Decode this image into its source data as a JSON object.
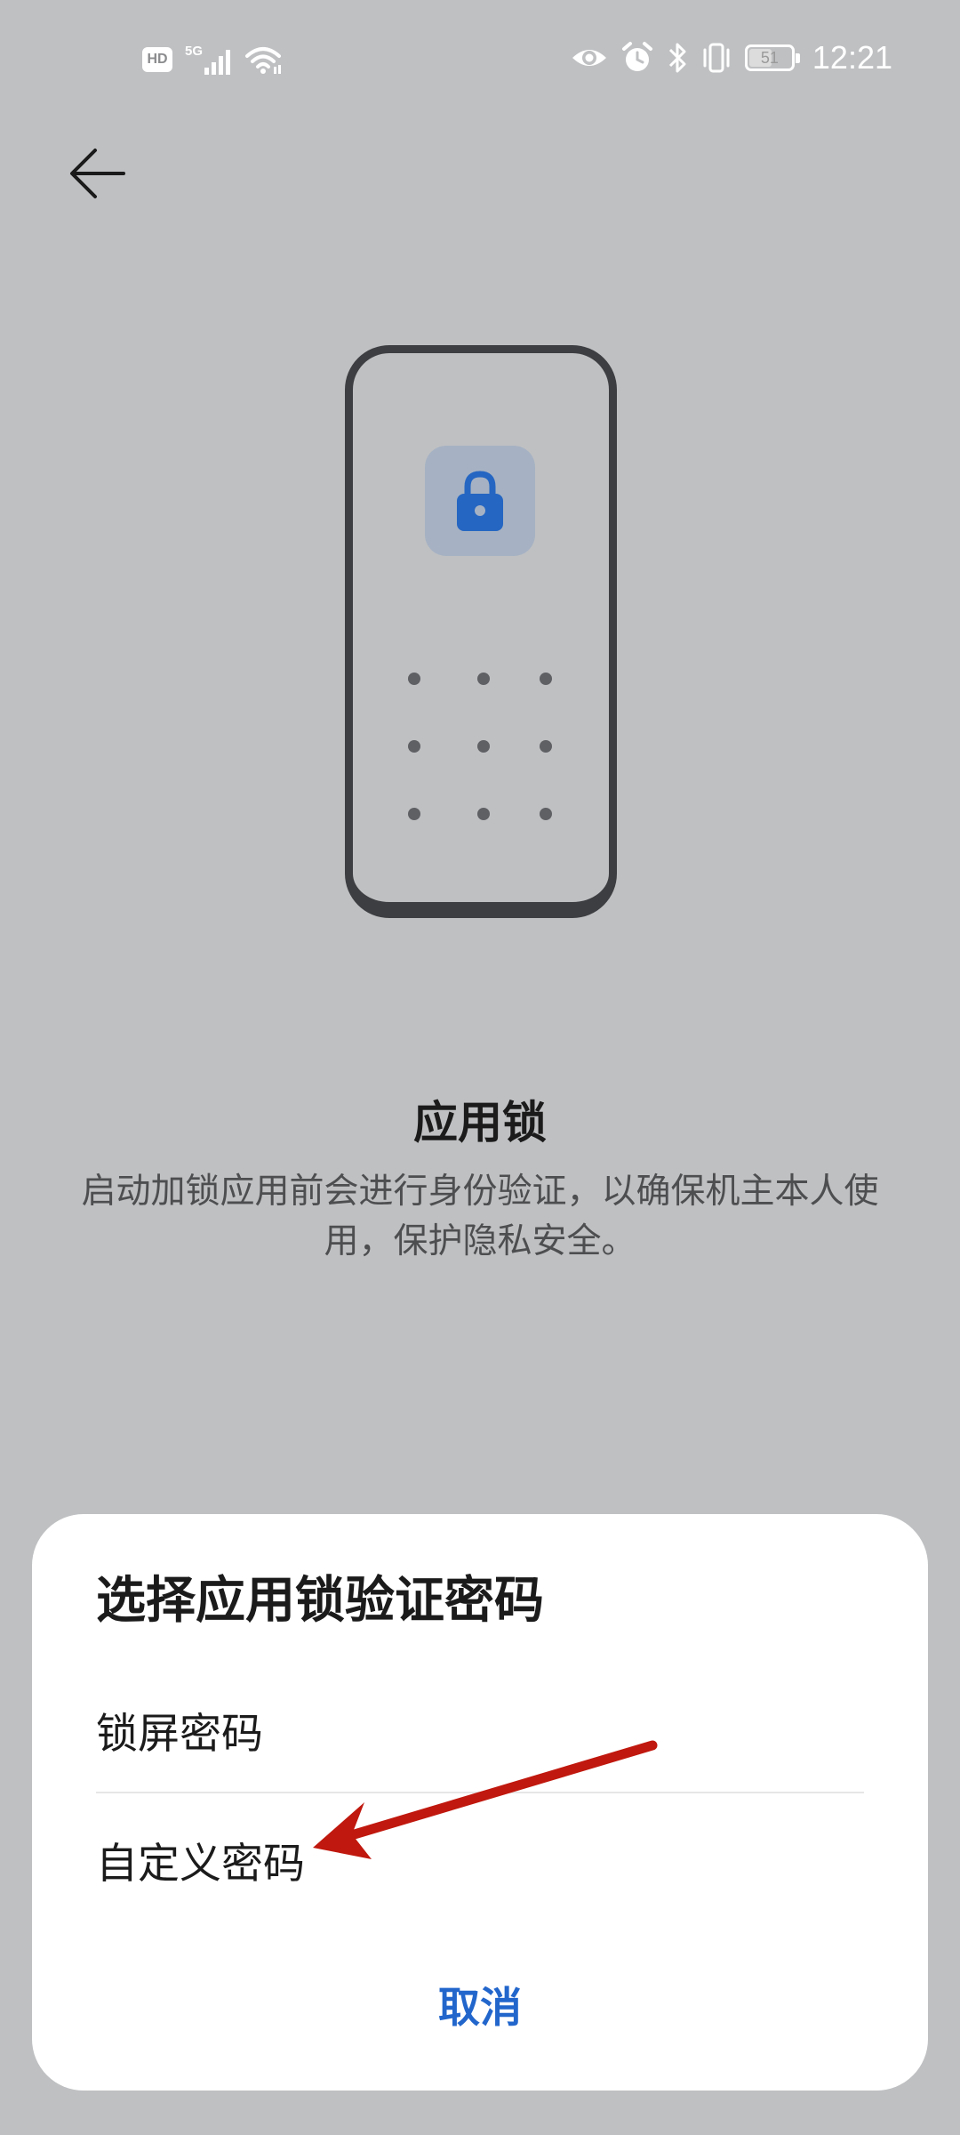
{
  "status_bar": {
    "hd_label": "HD",
    "network_label": "5G",
    "battery_level": "51",
    "time": "12:21",
    "icons": [
      "hd-icon",
      "signal-5g-icon",
      "wifi-icon",
      "eye-icon",
      "alarm-icon",
      "bluetooth-icon",
      "vibrate-icon",
      "battery-icon"
    ]
  },
  "header": {
    "back_icon": "arrow-left-icon"
  },
  "illustration": {
    "lock_icon": "lock-icon",
    "accent_color": "#2566c2"
  },
  "main": {
    "title": "应用锁",
    "description": "启动加锁应用前会进行身份验证，以确保机主本人使用，保护隐私安全。"
  },
  "sheet": {
    "title": "选择应用锁验证密码",
    "options": [
      {
        "label": "锁屏密码"
      },
      {
        "label": "自定义密码"
      }
    ],
    "cancel_label": "取消",
    "cancel_color": "#2266cc"
  },
  "annotation": {
    "arrow_color": "#c0180e"
  }
}
